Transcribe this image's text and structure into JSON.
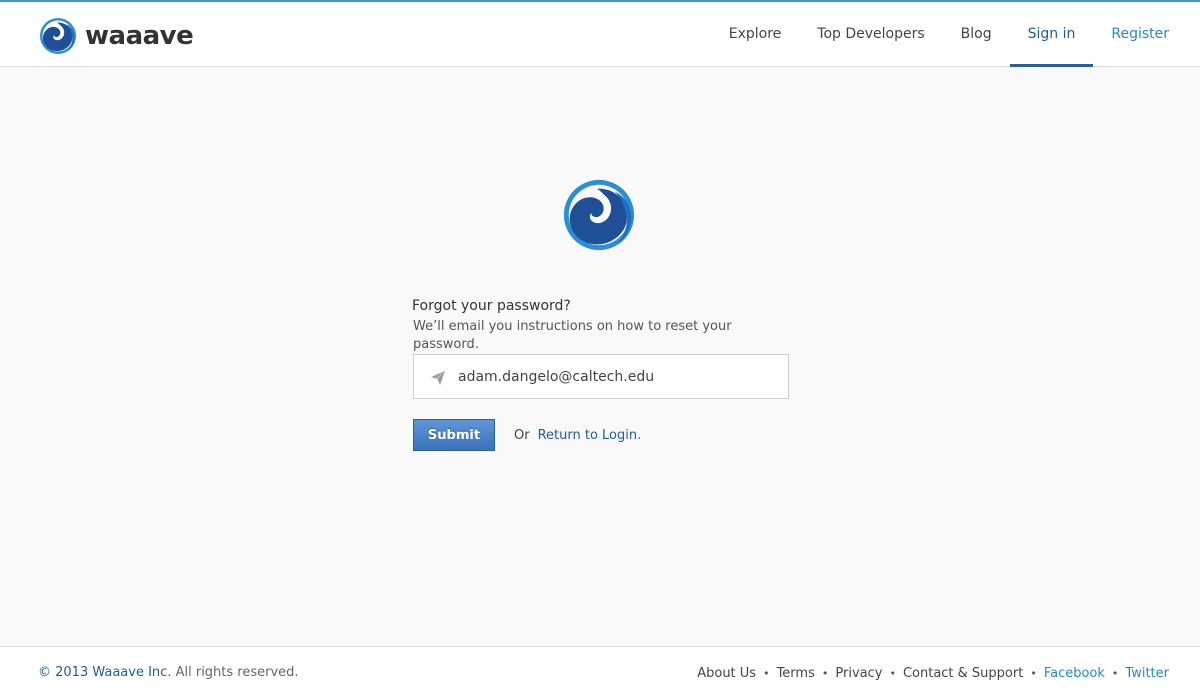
{
  "header": {
    "brand_name": "waaave",
    "nav": {
      "explore": "Explore",
      "top_developers": "Top Developers",
      "blog": "Blog",
      "sign_in": "Sign in",
      "register": "Register"
    },
    "active_item": "Sign in"
  },
  "form": {
    "heading": "Forgot your password?",
    "subtitle": "We’ll email you instructions on how to reset your password.",
    "email_value": "adam.dangelo@caltech.edu",
    "submit_label": "Submit",
    "or_text": "Or",
    "return_link": "Return to Login."
  },
  "footer": {
    "copyright_prefix": "© 2013 Waaave Inc.",
    "copyright_suffix": "All rights reserved.",
    "links": {
      "about": "About Us",
      "terms": "Terms",
      "privacy": "Privacy",
      "contact": "Contact & Support",
      "facebook": "Facebook",
      "twitter": "Twitter"
    },
    "separator": "•"
  },
  "icons": {
    "brand": "wave-logo-icon",
    "center": "wave-logo-icon",
    "email": "paper-plane-icon"
  },
  "colors": {
    "accent": "#27619a",
    "link": "#1d5e96",
    "social_link": "#2788c4",
    "button": "#4a83c8"
  }
}
